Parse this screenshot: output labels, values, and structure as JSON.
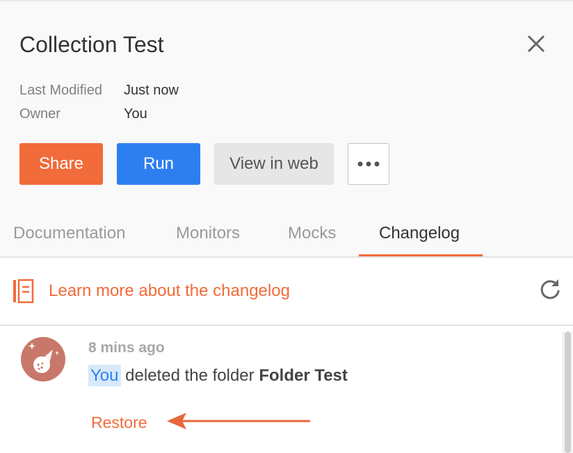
{
  "header": {
    "title": "Collection Test",
    "close_icon": "close-icon",
    "meta": [
      {
        "label": "Last Modified",
        "value": "Just now"
      },
      {
        "label": "Owner",
        "value": "You"
      }
    ]
  },
  "actions": {
    "share_label": "Share",
    "run_label": "Run",
    "view_web_label": "View in web",
    "more_icon": "more-horizontal-icon"
  },
  "tabs": [
    {
      "label": "Documentation",
      "active": false
    },
    {
      "label": "Monitors",
      "active": false
    },
    {
      "label": "Mocks",
      "active": false
    },
    {
      "label": "Changelog",
      "active": true
    }
  ],
  "changelog": {
    "learn_more_label": "Learn more about the changelog",
    "learn_icon": "changelog-book-icon",
    "refresh_icon": "refresh-icon",
    "entries": [
      {
        "time": "8 mins ago",
        "actor": "You",
        "action_text": "deleted the folder",
        "target": "Folder Test",
        "restore_label": "Restore",
        "avatar_icon": "comet-avatar-icon"
      }
    ]
  },
  "colors": {
    "accent_orange": "#f26b3a",
    "primary_blue": "#2d7ff0",
    "background": "#f9f9f9"
  }
}
